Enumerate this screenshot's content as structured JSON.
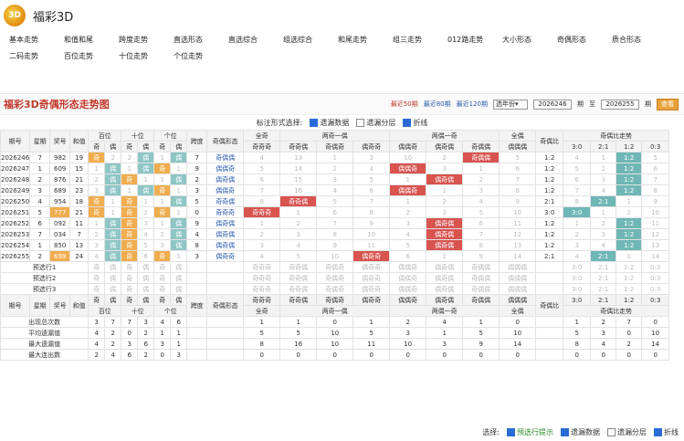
{
  "brand": "福彩3D",
  "nav": {
    "row1": [
      "基本走势",
      "和值和尾",
      "跨度走势",
      "直选形态",
      "直选综合",
      "组选综合",
      "和尾走势",
      "组三走势",
      "012路走势",
      "大小形态",
      "奇偶形态",
      "质合形态"
    ],
    "row2": [
      "二码走势",
      "百位走势",
      "十位走势",
      "个位走势"
    ]
  },
  "page_title": "福彩3D奇偶形态走势图",
  "filters": {
    "recent50": "最近50期",
    "recent80": "最近80期",
    "recent120": "最近120期",
    "select_label": "选年份",
    "from_value": "2026246",
    "from_unit": "期",
    "to_label": "至",
    "to_value": "2026255",
    "to_unit": "期",
    "query": "查看"
  },
  "options": {
    "label": "标注形式选择:",
    "missing": "遗漏数据",
    "layer": "遗漏分层",
    "line": "折线"
  },
  "columns": {
    "period": "期号",
    "week": "星期",
    "prize": "奖号",
    "sum": "和值",
    "hundreds": "百位",
    "tens": "十位",
    "ones": "个位",
    "span": "跨度",
    "shape": "奇偶形态",
    "all_odd": "全奇",
    "two_odd_one_even": "两奇一偶",
    "two_even_one_odd": "两偶一奇",
    "all_even": "全偶",
    "ratio": "奇偶比",
    "ratio_trend": "奇偶比走势"
  },
  "subheaders": {
    "odd": "奇",
    "even": "偶",
    "ooo": "奇奇奇",
    "ooe": "奇奇偶",
    "oeo": "奇偶奇",
    "eoo": "偶奇奇",
    "eeo": "偶偶奇",
    "eoe": "偶奇偶",
    "oee": "奇偶偶",
    "eee": "偶偶偶",
    "r30": "3:0",
    "r21": "2:1",
    "r12": "1:2",
    "r03": "0:3"
  },
  "rows": [
    {
      "p": "2026246",
      "w": "7",
      "n": "982",
      "s": "19",
      "pos": [
        [
          "奇",
          "2"
        ],
        [
          "2",
          "偶"
        ],
        [
          "1",
          "偶"
        ]
      ],
      "span": "7",
      "shape": "奇偶偶",
      "t": [
        "4",
        "13",
        "1",
        "3",
        "10",
        "2",
        "奇偶偶",
        "5"
      ],
      "r": "1:2",
      "rt": [
        "4",
        "1",
        "1:2",
        "5"
      ]
    },
    {
      "p": "2026247",
      "w": "1",
      "n": "609",
      "s": "15",
      "pos": [
        [
          "1",
          "偶"
        ],
        [
          "1",
          "偶"
        ],
        [
          "奇",
          "1"
        ]
      ],
      "span": "9",
      "shape": "偶偶奇",
      "t": [
        "5",
        "14",
        "2",
        "4",
        "偶偶奇",
        "3",
        "1",
        "6"
      ],
      "r": "1:2",
      "rt": [
        "5",
        "2",
        "1:2",
        "6"
      ]
    },
    {
      "p": "2026248",
      "w": "2",
      "n": "876",
      "s": "21",
      "pos": [
        [
          "2",
          "偶"
        ],
        [
          "奇",
          "1"
        ],
        [
          "1",
          "偶"
        ]
      ],
      "span": "2",
      "shape": "偶奇偶",
      "t": [
        "6",
        "15",
        "3",
        "5",
        "1",
        "偶奇偶",
        "2",
        "7"
      ],
      "r": "1:2",
      "rt": [
        "6",
        "3",
        "1:2",
        "7"
      ]
    },
    {
      "p": "2026249",
      "w": "3",
      "n": "689",
      "s": "23",
      "pos": [
        [
          "3",
          "偶"
        ],
        [
          "1",
          "偶"
        ],
        [
          "奇",
          "1"
        ]
      ],
      "span": "3",
      "shape": "偶偶奇",
      "t": [
        "7",
        "16",
        "4",
        "6",
        "偶偶奇",
        "1",
        "3",
        "8"
      ],
      "r": "1:2",
      "rt": [
        "7",
        "4",
        "1:2",
        "8"
      ]
    },
    {
      "p": "2026250",
      "w": "4",
      "n": "954",
      "s": "18",
      "pos": [
        [
          "奇",
          "1"
        ],
        [
          "奇",
          "1"
        ],
        [
          "1",
          "偶"
        ]
      ],
      "span": "5",
      "shape": "奇奇偶",
      "t": [
        "8",
        "奇奇偶",
        "5",
        "7",
        "1",
        "2",
        "4",
        "9"
      ],
      "r": "2:1",
      "rt": [
        "8",
        "2:1",
        "1",
        "9"
      ]
    },
    {
      "p": "2026251",
      "w": "5",
      "n": "777",
      "s": "21",
      "pos": [
        [
          "奇",
          "1"
        ],
        [
          "奇",
          "2"
        ],
        [
          "奇",
          "1"
        ]
      ],
      "span": "0",
      "shape": "奇奇奇",
      "t": [
        "奇奇奇",
        "1",
        "6",
        "8",
        "2",
        "3",
        "5",
        "10"
      ],
      "r": "3:0",
      "rt": [
        "3:0",
        "1",
        "2",
        "10"
      ]
    },
    {
      "p": "2026252",
      "w": "6",
      "n": "092",
      "s": "11",
      "pos": [
        [
          "1",
          "偶"
        ],
        [
          "奇",
          "3"
        ],
        [
          "1",
          "偶"
        ]
      ],
      "span": "9",
      "shape": "偶奇偶",
      "t": [
        "1",
        "2",
        "7",
        "9",
        "3",
        "偶奇偶",
        "6",
        "11"
      ],
      "r": "1:2",
      "rt": [
        "1",
        "2",
        "1:2",
        "11"
      ]
    },
    {
      "p": "2026253",
      "w": "7",
      "n": "034",
      "s": "7",
      "pos": [
        [
          "2",
          "偶"
        ],
        [
          "奇",
          "4"
        ],
        [
          "2",
          "偶"
        ]
      ],
      "span": "4",
      "shape": "偶奇偶",
      "t": [
        "2",
        "3",
        "8",
        "10",
        "4",
        "偶奇偶",
        "7",
        "12"
      ],
      "r": "1:2",
      "rt": [
        "2",
        "3",
        "1:2",
        "12"
      ]
    },
    {
      "p": "2026254",
      "w": "1",
      "n": "850",
      "s": "13",
      "pos": [
        [
          "3",
          "偶"
        ],
        [
          "奇",
          "5"
        ],
        [
          "3",
          "偶"
        ]
      ],
      "span": "8",
      "shape": "偶奇偶",
      "t": [
        "3",
        "4",
        "9",
        "11",
        "5",
        "偶奇偶",
        "8",
        "13"
      ],
      "r": "1:2",
      "rt": [
        "3",
        "4",
        "1:2",
        "13"
      ]
    },
    {
      "p": "2026255",
      "w": "2",
      "n": "699",
      "s": "24",
      "pos": [
        [
          "4",
          "偶"
        ],
        [
          "奇",
          "6"
        ],
        [
          "奇",
          "1"
        ]
      ],
      "span": "3",
      "shape": "偶奇奇",
      "t": [
        "4",
        "5",
        "10",
        "偶奇奇",
        "6",
        "1",
        "9",
        "14"
      ],
      "r": "2:1",
      "rt": [
        "4",
        "2:1",
        "1",
        "14"
      ]
    }
  ],
  "forecast": [
    "预选行1",
    "预选行2",
    "预选行3"
  ],
  "footer_labels": {
    "period": "期号",
    "week": "星期",
    "prize": "奖号",
    "sum": "和值",
    "span": "跨度",
    "shape": "奇偶形态",
    "ratio": "奇偶比",
    "all_odd": "全奇",
    "two_odd": "两奇一偶",
    "two_even": "两偶一奇",
    "all_even": "全偶",
    "ratio_trend": "奇偶比走势",
    "h": "百位",
    "t": "十位",
    "o": "个位"
  },
  "stats": [
    {
      "label": "出现总次数",
      "v": [
        "3",
        "7",
        "7",
        "3",
        "4",
        "6"
      ],
      "t": [
        "1",
        "1",
        "0",
        "1",
        "2",
        "4",
        "1",
        "0"
      ],
      "rt": [
        "1",
        "2",
        "7",
        "0"
      ]
    },
    {
      "label": "平均遗漏值",
      "v": [
        "4",
        "2",
        "0",
        "2",
        "1",
        "1"
      ],
      "t": [
        "5",
        "5",
        "10",
        "5",
        "3",
        "1",
        "5",
        "10"
      ],
      "rt": [
        "5",
        "3",
        "0",
        "10"
      ]
    },
    {
      "label": "最大遗漏值",
      "v": [
        "4",
        "2",
        "3",
        "6",
        "3",
        "1"
      ],
      "t": [
        "8",
        "16",
        "10",
        "11",
        "10",
        "3",
        "9",
        "14"
      ],
      "rt": [
        "8",
        "4",
        "2",
        "14"
      ]
    },
    {
      "label": "最大连出数",
      "v": [
        "2",
        "4",
        "6",
        "2",
        "0",
        "3"
      ],
      "t": [
        "0",
        "0",
        "0",
        "0",
        "0",
        "0",
        "0",
        "0"
      ],
      "rt": [
        "0",
        "0",
        "0",
        "0"
      ]
    }
  ],
  "bottom": {
    "label": "选择:",
    "forecast": "预选行提示",
    "missing": "遗漏数据",
    "layer": "遗漏分层",
    "line": "折线"
  }
}
